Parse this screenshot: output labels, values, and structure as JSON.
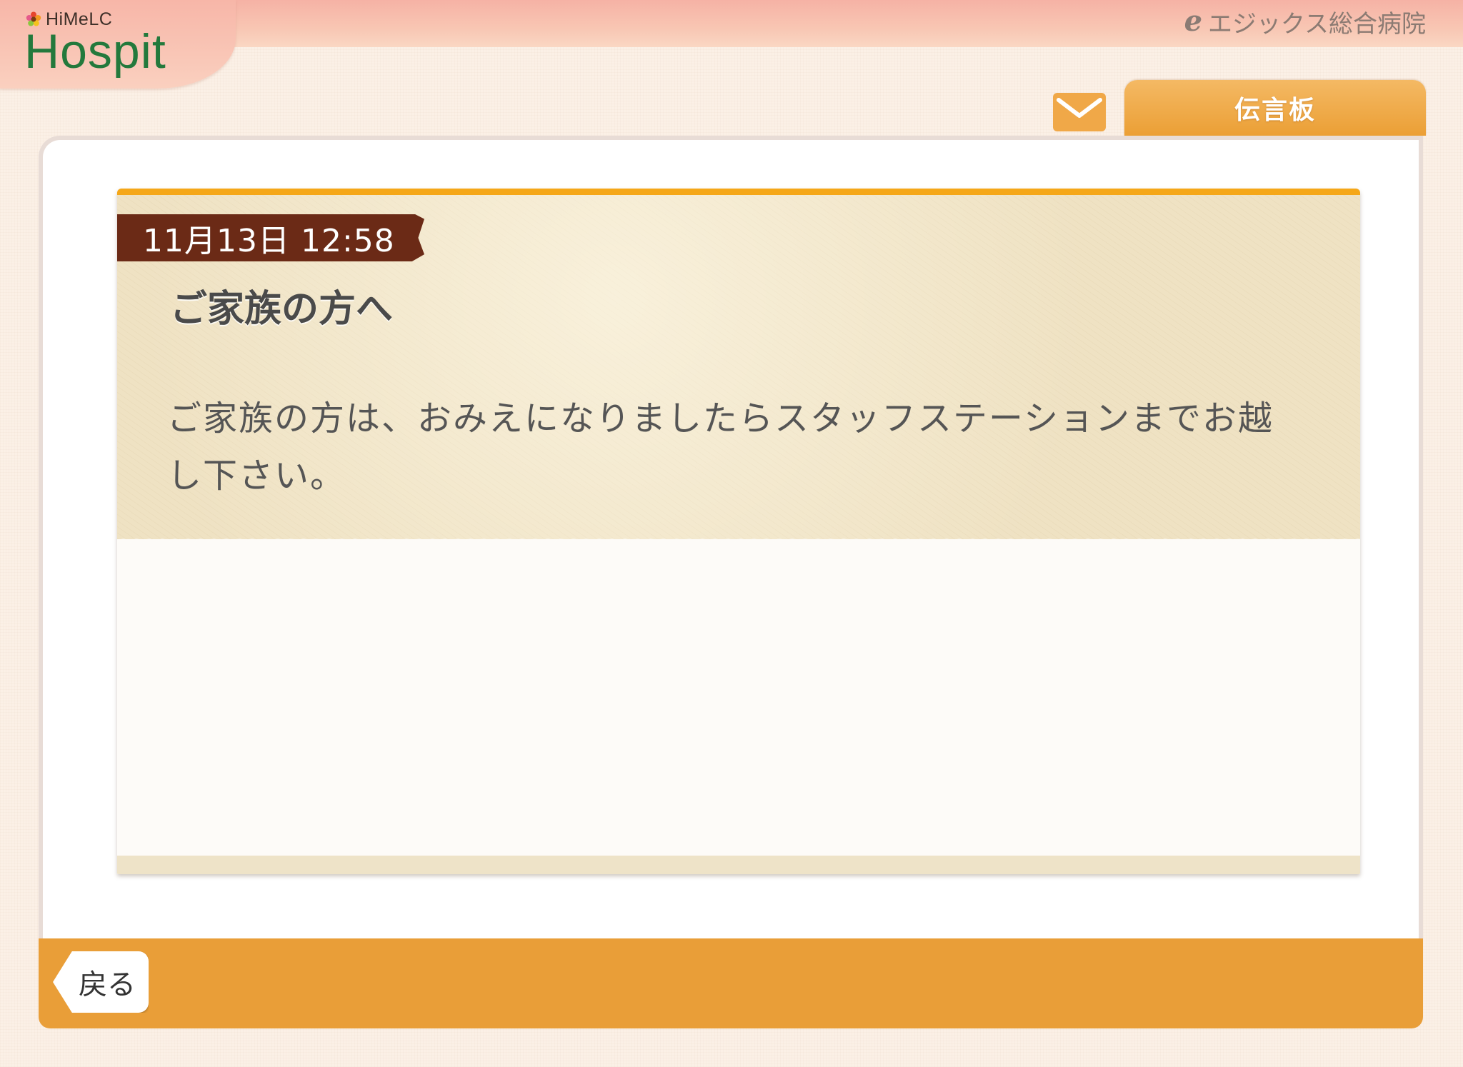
{
  "header": {
    "brand": "HiMeLC",
    "product": "Hospit",
    "hospital_name": "エジックス総合病院"
  },
  "tabs": {
    "mail_icon": "mail-icon",
    "board_label": "伝言板"
  },
  "message": {
    "datetime": "11月13日 12:58",
    "title": "ご家族の方へ",
    "body": "ご家族の方は、おみえになりましたらスタッフステーションまでお越し下さい。"
  },
  "footer": {
    "back_label": "戻る"
  },
  "colors": {
    "accent_orange": "#e99e38",
    "tab_orange": "#f0a848",
    "card_topbar": "#f5a718",
    "date_ribbon": "#6b2a16",
    "logo_green": "#23793c",
    "header_pink": "#f7b6a8"
  }
}
